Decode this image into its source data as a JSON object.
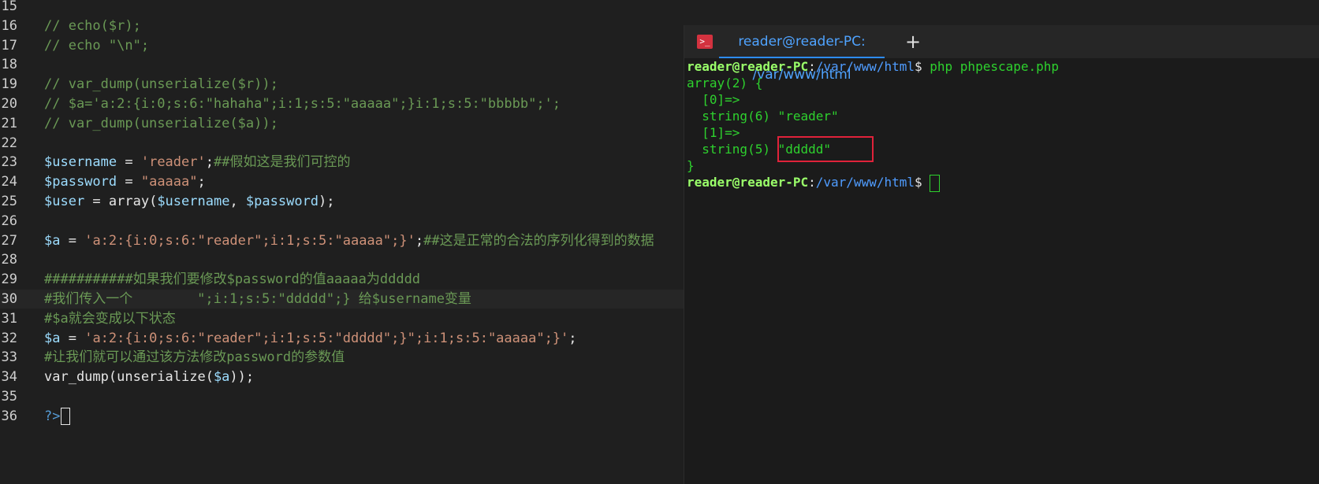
{
  "editor": {
    "lines": [
      {
        "num": "15",
        "parts": []
      },
      {
        "num": "16",
        "parts": [
          {
            "t": "com",
            "v": "// echo($r);"
          }
        ]
      },
      {
        "num": "17",
        "parts": [
          {
            "t": "com",
            "v": "// echo \"\\n\";"
          }
        ]
      },
      {
        "num": "18",
        "parts": []
      },
      {
        "num": "19",
        "parts": [
          {
            "t": "com",
            "v": "// var_dump(unserialize($r));"
          }
        ]
      },
      {
        "num": "20",
        "parts": [
          {
            "t": "com",
            "v": "// $a='a:2:{i:0;s:6:\"hahaha\";i:1;s:5:\"aaaaa\";}i:1;s:5:\"bbbbb\";';"
          }
        ]
      },
      {
        "num": "21",
        "parts": [
          {
            "t": "com",
            "v": "// var_dump(unserialize($a));"
          }
        ]
      },
      {
        "num": "22",
        "parts": []
      },
      {
        "num": "23",
        "parts": [
          {
            "t": "var",
            "v": "$username"
          },
          {
            "t": "txt",
            "v": " = "
          },
          {
            "t": "str",
            "v": "'reader'"
          },
          {
            "t": "txt",
            "v": ";"
          },
          {
            "t": "com",
            "v": "##假如这是我们可控的"
          }
        ]
      },
      {
        "num": "24",
        "parts": [
          {
            "t": "var",
            "v": "$password"
          },
          {
            "t": "txt",
            "v": " = "
          },
          {
            "t": "str",
            "v": "\"aaaaa\""
          },
          {
            "t": "txt",
            "v": ";"
          }
        ]
      },
      {
        "num": "25",
        "parts": [
          {
            "t": "var",
            "v": "$user"
          },
          {
            "t": "txt",
            "v": " = array("
          },
          {
            "t": "var",
            "v": "$username"
          },
          {
            "t": "txt",
            "v": ", "
          },
          {
            "t": "var",
            "v": "$password"
          },
          {
            "t": "txt",
            "v": ");"
          }
        ]
      },
      {
        "num": "26",
        "parts": []
      },
      {
        "num": "27",
        "parts": [
          {
            "t": "var",
            "v": "$a"
          },
          {
            "t": "txt",
            "v": " = "
          },
          {
            "t": "str",
            "v": "'a:2:{i:0;s:6:\"reader\";i:1;s:5:\"aaaaa\";}'"
          },
          {
            "t": "txt",
            "v": ";"
          },
          {
            "t": "com",
            "v": "##这是正常的合法的序列化得到的数据"
          }
        ]
      },
      {
        "num": "28",
        "parts": []
      },
      {
        "num": "29",
        "parts": [
          {
            "t": "com",
            "v": "###########如果我们要修改$password的值aaaaa为ddddd"
          }
        ]
      },
      {
        "num": "30",
        "parts": [
          {
            "t": "com",
            "v": "#我们传入一个        \";i:1;s:5:\"ddddd\";} 给$username变量"
          }
        ]
      },
      {
        "num": "31",
        "parts": [
          {
            "t": "com",
            "v": "#$a就会变成以下状态"
          }
        ]
      },
      {
        "num": "32",
        "parts": [
          {
            "t": "var",
            "v": "$a"
          },
          {
            "t": "txt",
            "v": " = "
          },
          {
            "t": "str",
            "v": "'a:2:{i:0;s:6:\"reader\";i:1;s:5:\"ddddd\";}\";i:1;s:5:\"aaaaa\";}'"
          },
          {
            "t": "txt",
            "v": ";"
          }
        ]
      },
      {
        "num": "33",
        "parts": [
          {
            "t": "com",
            "v": "#让我们就可以通过该方法修改password的参数值"
          }
        ]
      },
      {
        "num": "34",
        "parts": [
          {
            "t": "txt",
            "v": "var_dump(unserialize("
          },
          {
            "t": "var",
            "v": "$a"
          },
          {
            "t": "txt",
            "v": "));"
          }
        ]
      },
      {
        "num": "35",
        "parts": []
      },
      {
        "num": "36",
        "parts": [
          {
            "t": "php",
            "v": "?>"
          }
        ]
      }
    ]
  },
  "terminal": {
    "icon": ">_",
    "tab_title": "reader@reader-PC: /var/www/html",
    "add_label": "+",
    "prompt_user": "reader@reader-PC",
    "prompt_sep": ":",
    "prompt_path": "/var/www/html",
    "prompt_dollar": "$ ",
    "command": "php phpescape.php",
    "output": [
      "array(2) {",
      "  [0]=>",
      "  string(6) \"reader\"",
      "  [1]=>",
      "  string(5) \"ddddd\"",
      "}"
    ]
  },
  "colors": {
    "highlight_box": "#e0223a",
    "terminal_green": "#2ed12e",
    "tab_accent": "#2d8cff"
  }
}
